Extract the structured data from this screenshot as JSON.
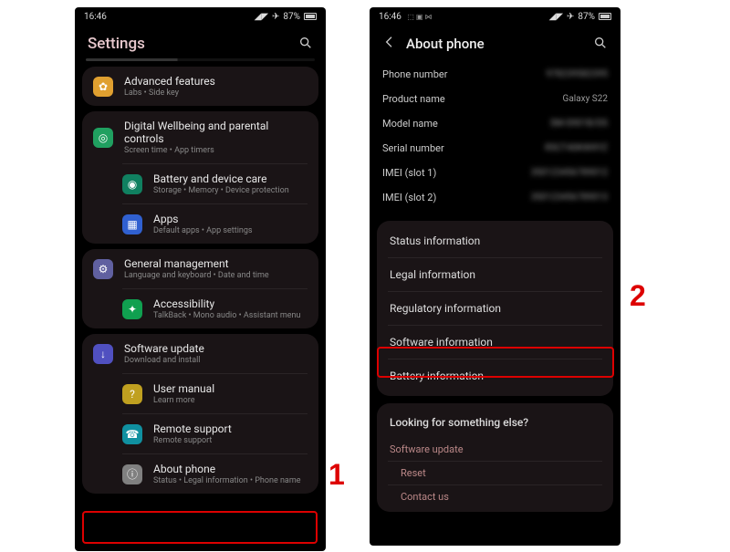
{
  "status": {
    "time": "16:46",
    "time2": "16:46",
    "icons2": "⬚ ▣ ⋈",
    "mute": "◢◤",
    "plane": "✈",
    "battery": "87%"
  },
  "left": {
    "title": "Settings",
    "g1": [
      {
        "icon": "#e0a030",
        "glyph": "✿",
        "label": "Advanced features",
        "sub": "Labs • Side key"
      }
    ],
    "g2": [
      {
        "icon": "#20a060",
        "glyph": "◎",
        "label": "Digital Wellbeing and parental controls",
        "sub": "Screen time • App timers"
      },
      {
        "icon": "#108060",
        "glyph": "◉",
        "label": "Battery and device care",
        "sub": "Storage • Memory • Device protection"
      },
      {
        "icon": "#3060d0",
        "glyph": "▦",
        "label": "Apps",
        "sub": "Default apps • App settings"
      }
    ],
    "g3": [
      {
        "icon": "#6060a0",
        "glyph": "⚙",
        "label": "General management",
        "sub": "Language and keyboard • Date and time"
      },
      {
        "icon": "#10a050",
        "glyph": "✦",
        "label": "Accessibility",
        "sub": "TalkBack • Mono audio • Assistant menu"
      }
    ],
    "g4": [
      {
        "icon": "#5050c0",
        "glyph": "↓",
        "label": "Software update",
        "sub": "Download and install"
      },
      {
        "icon": "#c0a020",
        "glyph": "?",
        "label": "User manual",
        "sub": "Learn more"
      },
      {
        "icon": "#1090a0",
        "glyph": "☎",
        "label": "Remote support",
        "sub": "Remote support"
      },
      {
        "icon": "#808080",
        "glyph": "ⓘ",
        "label": "About phone",
        "sub": "Status • Legal information • Phone name"
      }
    ]
  },
  "right": {
    "title": "About phone",
    "kv": [
      {
        "k": "Phone number",
        "v": "978239582395",
        "blur": true
      },
      {
        "k": "Product name",
        "v": "Galaxy S22",
        "blur": false
      },
      {
        "k": "Model name",
        "v": "SM-S901B/DS",
        "blur": true
      },
      {
        "k": "Serial number",
        "v": "R5CT40KWXYZ",
        "blur": true
      },
      {
        "k": "IMEI (slot 1)",
        "v": "350123456789012",
        "blur": true
      },
      {
        "k": "IMEI (slot 2)",
        "v": "350123456789013",
        "blur": true
      }
    ],
    "info": [
      "Status information",
      "Legal information",
      "Regulatory information",
      "Software information",
      "Battery information"
    ],
    "looking": {
      "head": "Looking for something else?",
      "links": [
        "Software update",
        "Reset",
        "Contact us"
      ]
    }
  },
  "annot": {
    "num1": "1",
    "num2": "2"
  }
}
